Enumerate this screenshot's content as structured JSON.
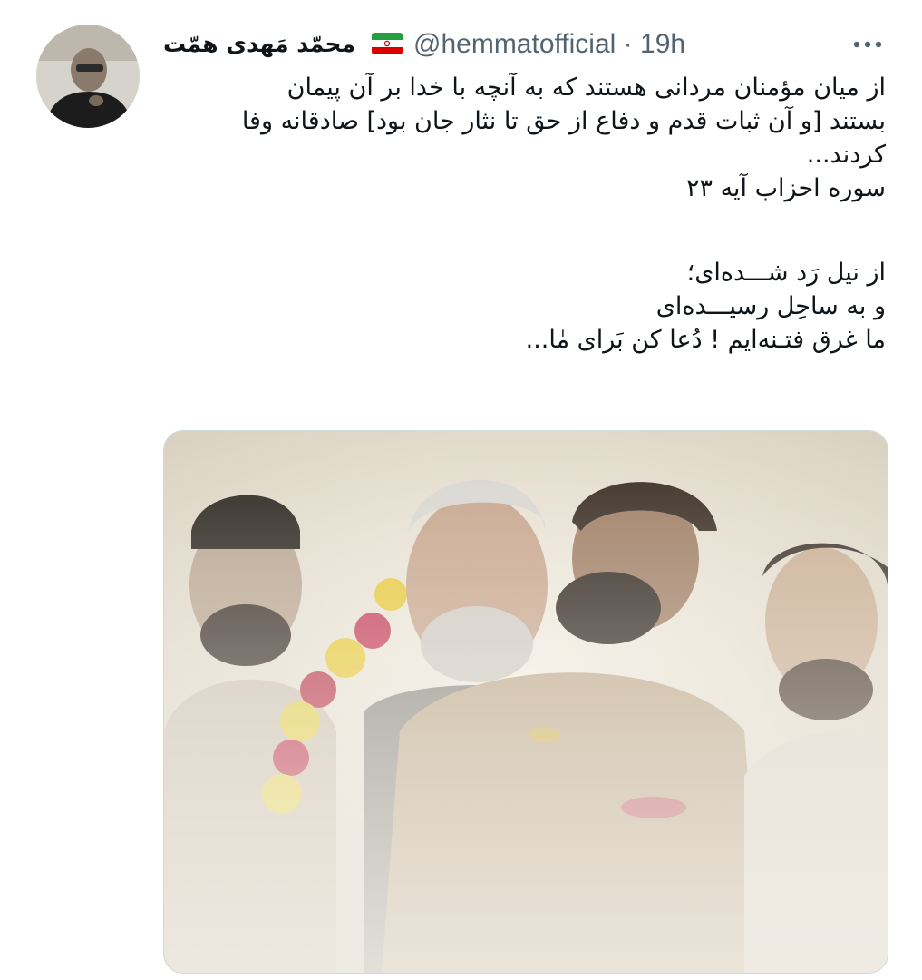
{
  "tweet": {
    "author": {
      "display_name": "محمّد مَهدی همّت",
      "handle": "@hemmatofficial",
      "flag_icon": "iran-flag-icon",
      "avatar_icon": "profile-avatar"
    },
    "separator": "·",
    "time": "19h",
    "more_icon": "more-dots-icon",
    "text_lines": [
      "از میان مؤمنان مردانی هستند که به آنچه با خدا بر آن پیمان",
      "بستند [و آن ثبات قدم و دفاع از حق تا نثار جان بود] صادقانه وفا",
      "کردند...",
      "سوره احزاب آیه ۲۳",
      "",
      "از نیل رَد شـــده‌ای؛",
      "و به ساحِل رسیـــده‌ای",
      "ما غرق فتـنه‌ایم ! دُعا کن بَرای مٰا..."
    ],
    "media": {
      "type": "photo"
    },
    "colors": {
      "text": "#0f1419",
      "secondary": "#536471",
      "border": "#cfd9de"
    }
  }
}
